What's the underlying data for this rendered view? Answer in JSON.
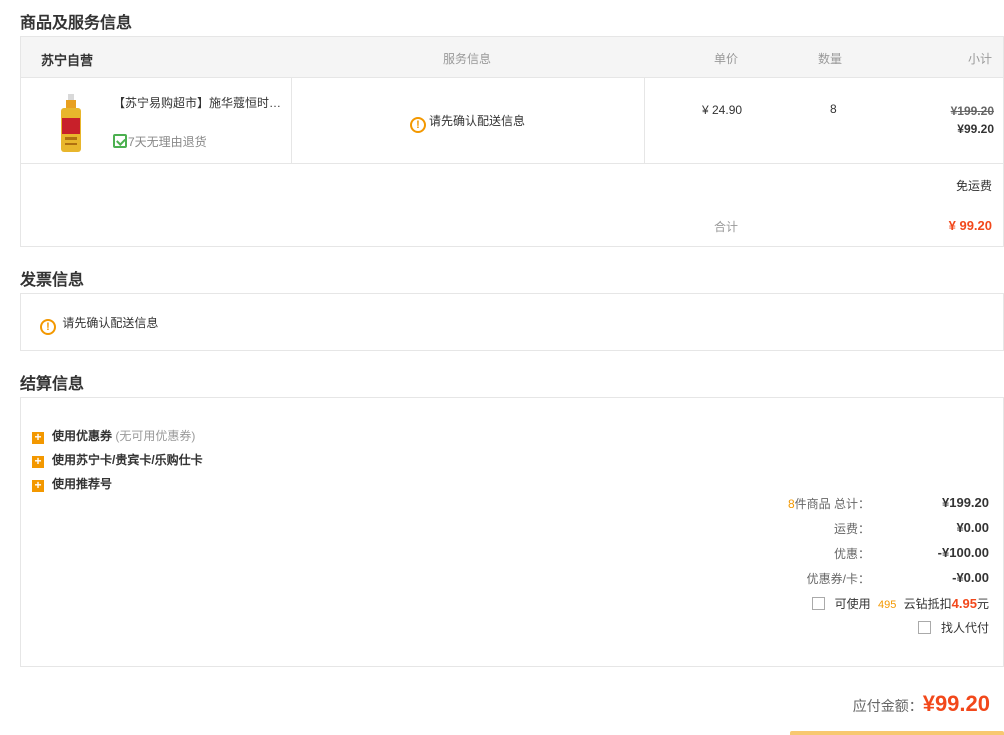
{
  "sections": {
    "goods_title": "商品及服务信息",
    "invoice_title": "发票信息",
    "settle_title": "结算信息"
  },
  "table": {
    "store": "苏宁自营",
    "col_service": "服务信息",
    "col_price": "单价",
    "col_qty": "数量",
    "col_subtotal": "小计"
  },
  "item": {
    "name": "【苏宁易购超市】施华蔻恒时珍…",
    "return_policy": "7天无理由退货",
    "service_notice": "请先确认配送信息",
    "price": "¥ 24.90",
    "quantity": "8",
    "original_subtotal": "¥199.20",
    "subtotal": "¥99.20"
  },
  "shipping": "免运费",
  "total_label": "合计",
  "total_value": "¥ 99.20",
  "invoice": {
    "notice": "请先确认配送信息"
  },
  "settlement": {
    "coupon_label": "使用优惠券",
    "coupon_sub": "(无可用优惠券)",
    "card_label": "使用苏宁卡/贵宾卡/乐购仕卡",
    "referrer_label": "使用推荐号",
    "count": "8",
    "goods_total_label": "件商品  总计：",
    "goods_total": "¥199.20",
    "freight_label": "运费：",
    "freight": "¥0.00",
    "discount_label": "优惠：",
    "discount": "-¥100.00",
    "coupon_card_label": "优惠券/卡：",
    "coupon_card": "-¥0.00",
    "diamond_prefix": "可使用",
    "diamond_count": "495",
    "diamond_middle": "云钻抵扣",
    "diamond_amount": "4.95",
    "diamond_unit": "元",
    "proxy_pay": "找人代付"
  },
  "payable": {
    "label": "应付金额：",
    "value": "¥99.20"
  },
  "colors": {
    "accent": "#f39800",
    "price_red": "#f2481b"
  }
}
